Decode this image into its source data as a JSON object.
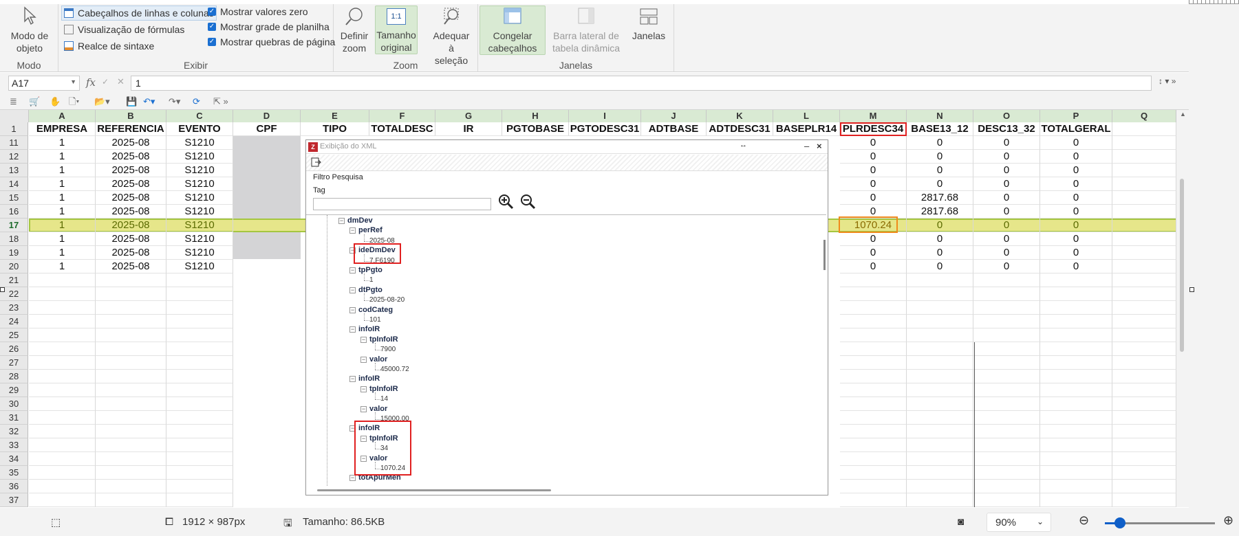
{
  "ribbon": {
    "modo": {
      "btn": "Modo de objeto",
      "group": "Modo"
    },
    "exibir": {
      "group": "Exibir",
      "cabecalhos": "Cabeçalhos de linhas e colunas",
      "visualizacao": "Visualização de fórmulas",
      "realce": "Realce de sintaxe",
      "zero": "Mostrar valores zero",
      "grade": "Mostrar grade de planilha",
      "quebras": "Mostrar quebras de página"
    },
    "zoom": {
      "group": "Zoom",
      "definir": "Definir zoom",
      "tamanho": "Tamanho original",
      "tamanho_icon": "1:1",
      "adequar": "Adequar à seleção"
    },
    "janelas": {
      "group": "Janelas",
      "congelar": "Congelar cabeçalhos",
      "barra": "Barra lateral de tabela dinâmica",
      "janelas": "Janelas"
    }
  },
  "formula": {
    "cell": "A17",
    "fx": "fx",
    "value": "1"
  },
  "columns": [
    "A",
    "B",
    "C",
    "D",
    "E",
    "F",
    "G",
    "H",
    "I",
    "J",
    "K",
    "L",
    "M",
    "N",
    "O",
    "P",
    "Q"
  ],
  "header_row": {
    "num": "1",
    "cells": [
      "EMPRESA",
      "REFERENCIA",
      "EVENTO",
      "CPF",
      "TIPO",
      "TOTALDESC",
      "IR",
      "PGTOBASE",
      "PGTODESC31",
      "ADTBASE",
      "ADTDESC31",
      "BASEPLR14",
      "PLRDESC34",
      "BASE13_12",
      "DESC13_32",
      "TOTALGERAL",
      ""
    ]
  },
  "rows": [
    {
      "num": "11",
      "a": "1",
      "b": "2025-08",
      "c": "S1210",
      "m": "0",
      "n": "0",
      "o": "0",
      "p": "0"
    },
    {
      "num": "12",
      "a": "1",
      "b": "2025-08",
      "c": "S1210",
      "m": "0",
      "n": "0",
      "o": "0",
      "p": "0"
    },
    {
      "num": "13",
      "a": "1",
      "b": "2025-08",
      "c": "S1210",
      "m": "0",
      "n": "0",
      "o": "0",
      "p": "0"
    },
    {
      "num": "14",
      "a": "1",
      "b": "2025-08",
      "c": "S1210",
      "m": "0",
      "n": "0",
      "o": "0",
      "p": "0"
    },
    {
      "num": "15",
      "a": "1",
      "b": "2025-08",
      "c": "S1210",
      "m": "0",
      "n": "2817.68",
      "o": "0",
      "p": "0"
    },
    {
      "num": "16",
      "a": "1",
      "b": "2025-08",
      "c": "S1210",
      "m": "0",
      "n": "2817.68",
      "o": "0",
      "p": "0"
    },
    {
      "num": "17",
      "a": "1",
      "b": "2025-08",
      "c": "S1210",
      "m": "1070.24",
      "n": "0",
      "o": "0",
      "p": "0"
    },
    {
      "num": "18",
      "a": "1",
      "b": "2025-08",
      "c": "S1210",
      "m": "0",
      "n": "0",
      "o": "0",
      "p": "0"
    },
    {
      "num": "19",
      "a": "1",
      "b": "2025-08",
      "c": "S1210",
      "m": "0",
      "n": "0",
      "o": "0",
      "p": "0"
    },
    {
      "num": "20",
      "a": "1",
      "b": "2025-08",
      "c": "S1210",
      "m": "0",
      "n": "0",
      "o": "0",
      "p": "0"
    }
  ],
  "empty_rows": [
    "21",
    "22",
    "23",
    "24",
    "25",
    "26",
    "27",
    "28",
    "29",
    "30",
    "31",
    "32",
    "33",
    "34",
    "35",
    "36",
    "37"
  ],
  "dialog": {
    "title": "Exibição do XML",
    "filter": "Filtro Pesquisa",
    "tag_label": "Tag",
    "nodes": [
      {
        "t": "dmDev",
        "k": "b"
      },
      {
        "t": "perRef",
        "k": "b"
      },
      {
        "t": "2025-08",
        "k": "v"
      },
      {
        "t": "ideDmDev",
        "k": "b"
      },
      {
        "t": "7.F6190",
        "k": "v"
      },
      {
        "t": "tpPgto",
        "k": "b"
      },
      {
        "t": "1",
        "k": "v"
      },
      {
        "t": "dtPgto",
        "k": "b"
      },
      {
        "t": "2025-08-20",
        "k": "v"
      },
      {
        "t": "codCateg",
        "k": "b"
      },
      {
        "t": "101",
        "k": "v"
      },
      {
        "t": "infoIR",
        "k": "b"
      },
      {
        "t": "tpInfoIR",
        "k": "b"
      },
      {
        "t": "7900",
        "k": "v"
      },
      {
        "t": "valor",
        "k": "b"
      },
      {
        "t": "45000.72",
        "k": "v"
      },
      {
        "t": "infoIR",
        "k": "b"
      },
      {
        "t": "tpInfoIR",
        "k": "b"
      },
      {
        "t": "14",
        "k": "v"
      },
      {
        "t": "valor",
        "k": "b"
      },
      {
        "t": "15000.00",
        "k": "v"
      },
      {
        "t": "infoIR",
        "k": "b"
      },
      {
        "t": "tpInfoIR",
        "k": "b"
      },
      {
        "t": "34",
        "k": "v"
      },
      {
        "t": "valor",
        "k": "b"
      },
      {
        "t": "1070.24",
        "k": "v"
      },
      {
        "t": "totApurMen",
        "k": "b"
      }
    ]
  },
  "status": {
    "dims": "1912 × 987px",
    "size": "Tamanho: 86.5KB",
    "zoom": "90%"
  },
  "colors": {
    "selected_row": "#e6e68a",
    "highlight_red": "#e02020",
    "highlight_orange": "#f08a1c",
    "accent": "#1a6fd1"
  }
}
